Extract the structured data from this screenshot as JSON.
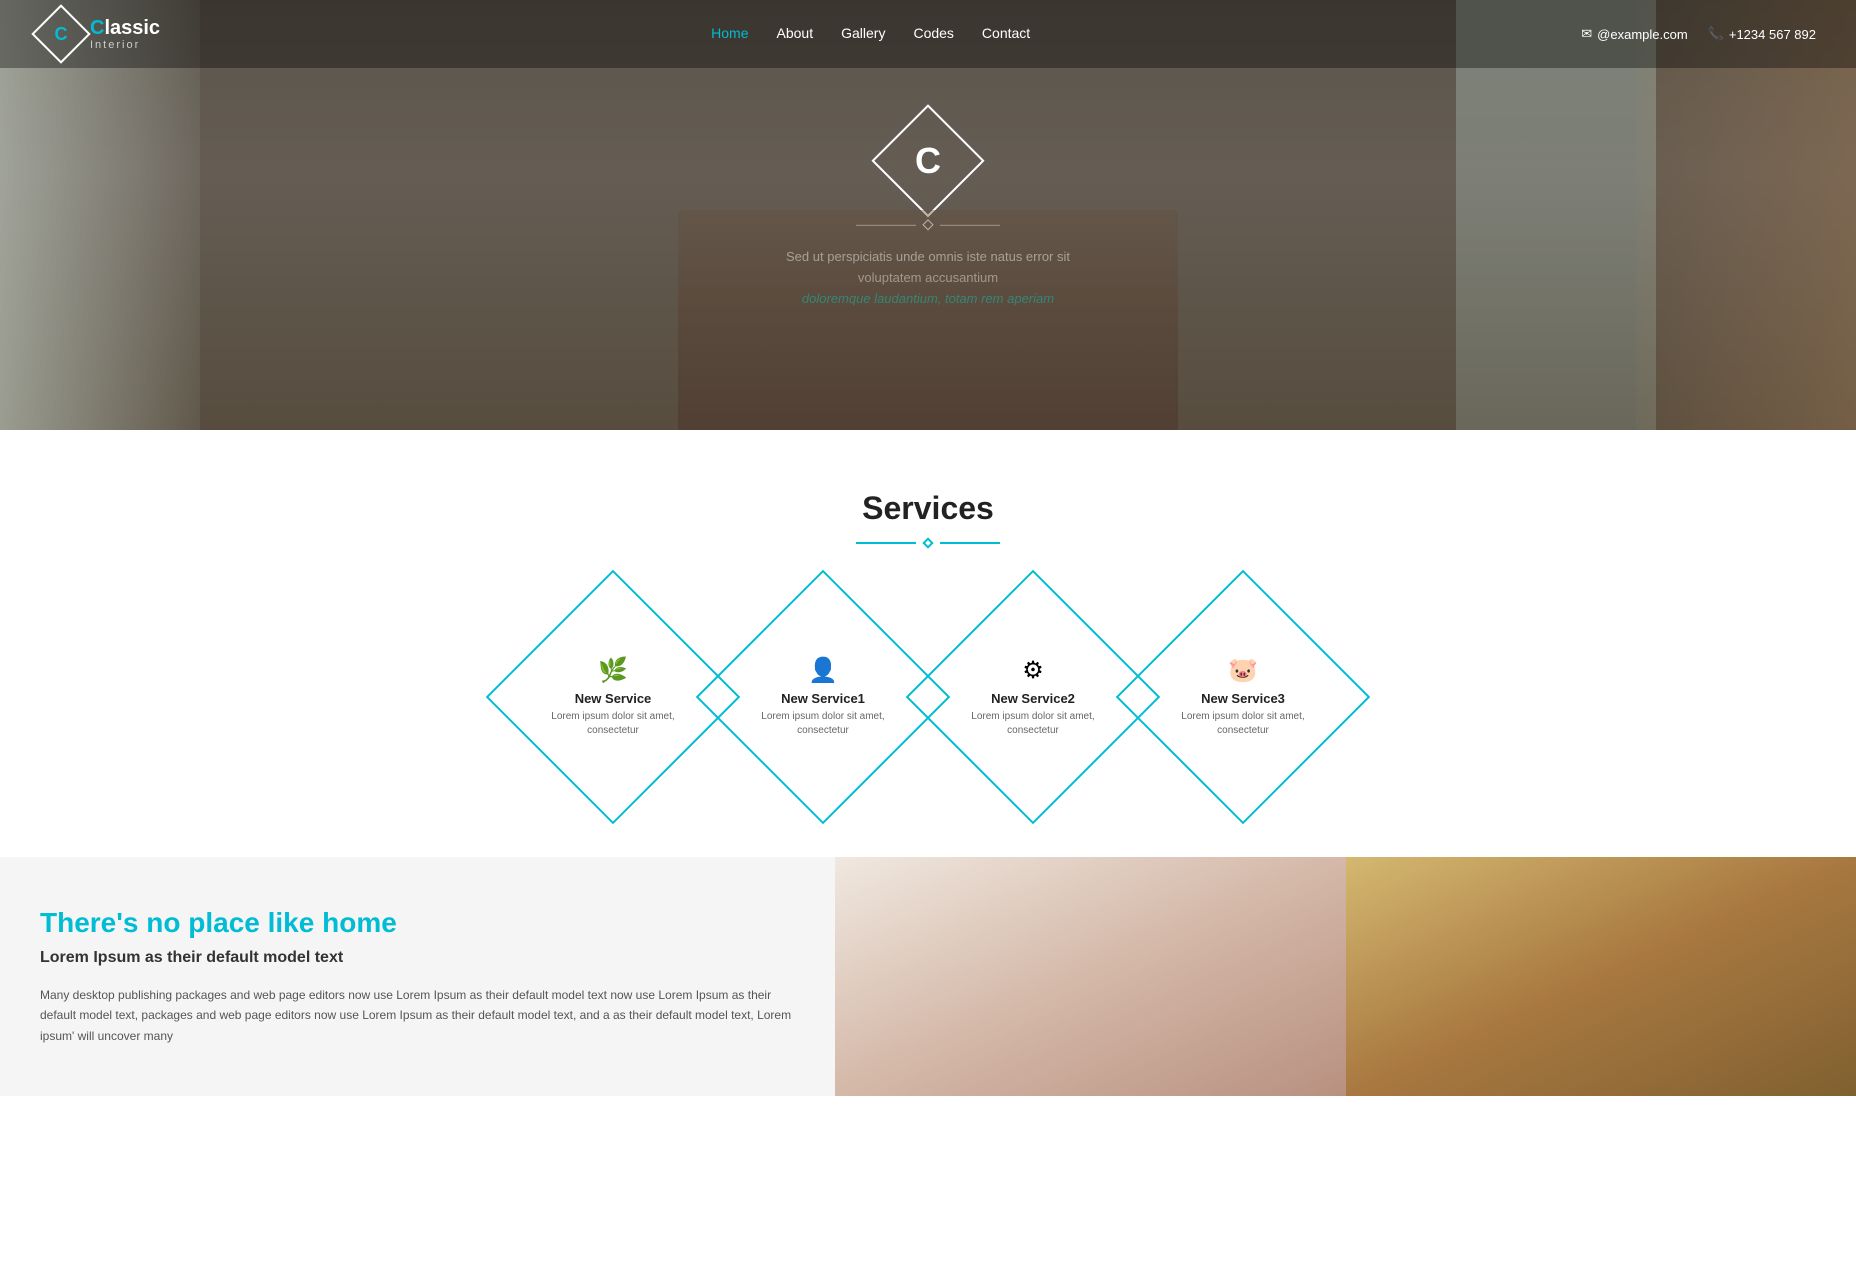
{
  "navbar": {
    "logo_letter": "C",
    "logo_brand": "lassic",
    "logo_sub": "Interior",
    "nav_links": [
      {
        "label": "Home",
        "href": "#",
        "active": true
      },
      {
        "label": "About",
        "href": "#",
        "active": false
      },
      {
        "label": "Gallery",
        "href": "#",
        "active": false
      },
      {
        "label": "Codes",
        "href": "#",
        "active": false
      },
      {
        "label": "Contact",
        "href": "#",
        "active": false
      }
    ],
    "email": "@example.com",
    "phone": "+1234 567 892"
  },
  "hero": {
    "logo_letter": "C",
    "body_text_line1": "Sed ut perspiciatis unde omnis iste natus error sit voluptatem accusantium",
    "body_text_line2": "doloremque laudantium, totam rem aperiam"
  },
  "services": {
    "section_title": "Services",
    "items": [
      {
        "icon": "🌿",
        "name": "New Service",
        "description": "Lorem ipsum dolor sit amet, consectetur"
      },
      {
        "icon": "👤",
        "name": "New Service1",
        "description": "Lorem ipsum dolor sit amet, consectetur"
      },
      {
        "icon": "⚙",
        "name": "New Service2",
        "description": "Lorem ipsum dolor sit amet, consectetur"
      },
      {
        "icon": "🐷",
        "name": "New Service3",
        "description": "Lorem ipsum dolor sit amet, consectetur"
      }
    ]
  },
  "home_section": {
    "heading": "There's no place like home",
    "subheading": "Lorem Ipsum as their default model text",
    "body": "Many desktop publishing packages and web page editors now use Lorem Ipsum as their default model text now use Lorem Ipsum as their default model text, packages and web page editors now use Lorem Ipsum as their default model text, and a as their default model text, Lorem ipsum' will uncover many"
  }
}
